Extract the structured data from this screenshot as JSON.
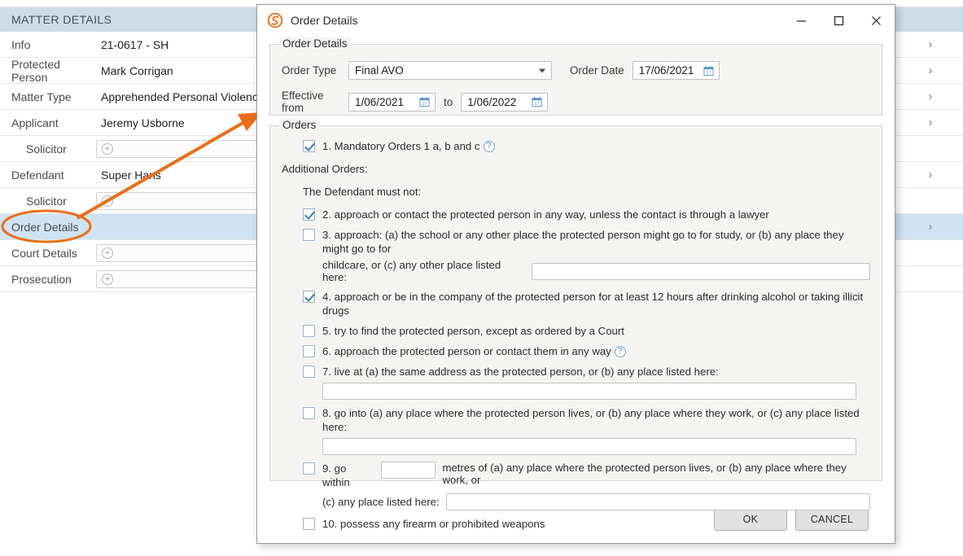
{
  "background": {
    "panel_title": "MATTER DETAILS",
    "rows": [
      {
        "label": "Info",
        "value": "21-0617 - SH",
        "indent": false,
        "kind": "value",
        "chevron": true,
        "selected": false
      },
      {
        "label": "Protected Person",
        "value": "Mark Corrigan",
        "indent": false,
        "kind": "value",
        "chevron": true,
        "selected": false
      },
      {
        "label": "Matter Type",
        "value": "Apprehended Personal Violence",
        "indent": false,
        "kind": "value",
        "chevron": true,
        "selected": false
      },
      {
        "label": "Applicant",
        "value": "Jeremy Usborne",
        "indent": false,
        "kind": "value",
        "chevron": true,
        "selected": false
      },
      {
        "label": "Solicitor",
        "value": "",
        "indent": true,
        "kind": "add",
        "chevron": false,
        "selected": false
      },
      {
        "label": "Defendant",
        "value": "Super Hans",
        "indent": false,
        "kind": "value",
        "chevron": true,
        "selected": false
      },
      {
        "label": "Solicitor",
        "value": "",
        "indent": true,
        "kind": "add",
        "chevron": false,
        "selected": false
      },
      {
        "label": "Order Details",
        "value": "",
        "indent": false,
        "kind": "value",
        "chevron": true,
        "selected": true
      },
      {
        "label": "Court Details",
        "value": "",
        "indent": false,
        "kind": "add",
        "chevron": false,
        "selected": false
      },
      {
        "label": "Prosecution",
        "value": "",
        "indent": false,
        "kind": "add",
        "chevron": false,
        "selected": false
      }
    ],
    "add_icon": "plus-circle-icon",
    "chevron_glyph": "›",
    "annotation_color": "#e8701a",
    "annotation_target_label": "Order Details"
  },
  "dialog": {
    "title": "Order Details",
    "app_icon": "swirl-s-logo",
    "window_controls": {
      "minimize": "—",
      "maximize": "☐",
      "close": "✕"
    },
    "order_details_group": {
      "legend": "Order Details",
      "order_type_label": "Order Type",
      "order_type_value": "Final AVO",
      "order_date_label": "Order Date",
      "order_date_value": "17/06/2021",
      "effective_from_label": "Effective from",
      "effective_from_value": "1/06/2021",
      "to_label": "to",
      "effective_to_value": "1/06/2022",
      "calendar_icon": "calendar-icon",
      "dropdown_icon": "chevron-down-icon"
    },
    "orders_group": {
      "legend": "Orders",
      "mandatory": {
        "number": "1.",
        "text": "1. Mandatory Orders 1 a, b and c",
        "checked": true,
        "help_icon": "question-mark-icon",
        "help_glyph": "?"
      },
      "additional_orders_label": "Additional Orders:",
      "must_not_label": "The Defendant must not:",
      "items": [
        {
          "id": "order-2",
          "checked": true,
          "text": "2. approach or contact the protected person in any way, unless the contact is through a lawyer",
          "help": false,
          "input": "none"
        },
        {
          "id": "order-3",
          "checked": false,
          "text": "3. approach: (a) the school or any other place the protected person might go to for study, or (b) any place they might go to for",
          "text2": "childcare, or (c) any other place listed here:",
          "help": false,
          "input": "inline",
          "input_value": ""
        },
        {
          "id": "order-4",
          "checked": true,
          "text": "4. approach or be in the company of the protected person for at least 12 hours after drinking alcohol or taking illicit drugs",
          "help": false,
          "input": "none"
        },
        {
          "id": "order-5",
          "checked": false,
          "text": "5. try to find the protected person, except as ordered by a Court",
          "help": false,
          "input": "none"
        },
        {
          "id": "order-6",
          "checked": false,
          "text": "6. approach the protected person or contact them in any way",
          "help": true,
          "help_glyph": "?",
          "input": "none"
        },
        {
          "id": "order-7",
          "checked": false,
          "text": "7. live at (a) the same address as the protected person, or (b) any place listed here:",
          "help": false,
          "input": "below",
          "input_value": ""
        },
        {
          "id": "order-8",
          "checked": false,
          "text": "8. go into (a) any place where the protected person lives, or (b) any place where they work, or (c) any place listed here:",
          "help": false,
          "input": "below",
          "input_value": ""
        },
        {
          "id": "order-9",
          "checked": false,
          "text": "9. go within",
          "text_mid": "metres of (a) any place where the protected person lives, or (b) any place where they work, or",
          "text2": "(c) any place listed here:",
          "help": false,
          "input": "metres",
          "metres_value": "",
          "input_value": ""
        },
        {
          "id": "order-10",
          "checked": false,
          "text": "10. possess any firearm or prohibited weapons",
          "help": false,
          "input": "none"
        }
      ]
    },
    "footer": {
      "ok_label": "OK",
      "cancel_label": "CANCEL"
    }
  },
  "colors": {
    "accent_orange": "#e8701a",
    "header_blue": "#ccdceb",
    "selected_row_blue": "#cfe3f5",
    "groupbox_bg": "#f4f4f2",
    "check_blue": "#3a7cc4"
  }
}
